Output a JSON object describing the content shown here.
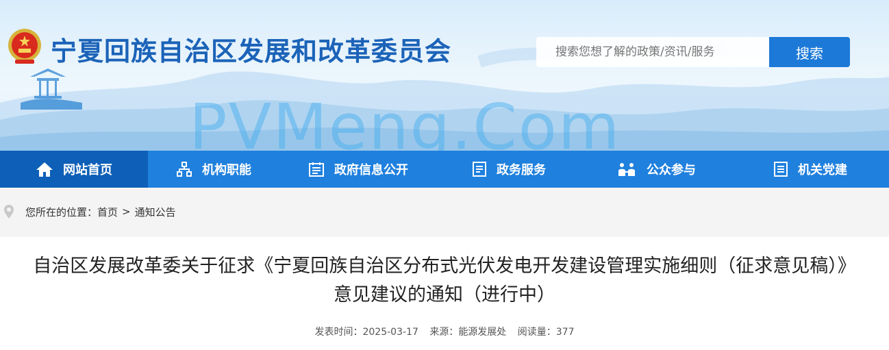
{
  "header": {
    "site_title": "宁夏回族自治区发展和改革委员会",
    "watermark": "PVMeng.Com",
    "emblem_icon": "national-emblem-icon"
  },
  "search": {
    "placeholder": "搜索您想了解的政策/资讯/服务",
    "button_label": "搜索"
  },
  "nav": {
    "items": [
      {
        "label": "网站首页",
        "icon": "home-icon",
        "active": true
      },
      {
        "label": "机构职能",
        "icon": "org-chart-icon",
        "active": false
      },
      {
        "label": "政府信息公开",
        "icon": "calendar-list-icon",
        "active": false
      },
      {
        "label": "政务服务",
        "icon": "document-list-icon",
        "active": false
      },
      {
        "label": "公众参与",
        "icon": "people-icon",
        "active": false
      },
      {
        "label": "机关党建",
        "icon": "document-icon",
        "active": false
      }
    ]
  },
  "breadcrumb": {
    "prefix": "您所在的位置：",
    "home": "首页",
    "separator": ">",
    "current": "通知公告",
    "icon": "location-pin-icon"
  },
  "article": {
    "title_line1": "自治区发展改革委关于征求《宁夏回族自治区分布式光伏发电开发建设管理实施细则（征求意见稿）》",
    "title_line2": "意见建议的通知（进行中）",
    "publish_label": "发表时间：",
    "publish_date": "2025-03-17",
    "source_label": "来源：",
    "source": "能源发展处",
    "views_label": "阅读量：",
    "views": "377"
  },
  "colors": {
    "brand_blue": "#1f80de",
    "nav_active": "#0d5fb7",
    "title_blue": "#1b63b8",
    "search_button": "#1c79d8"
  }
}
